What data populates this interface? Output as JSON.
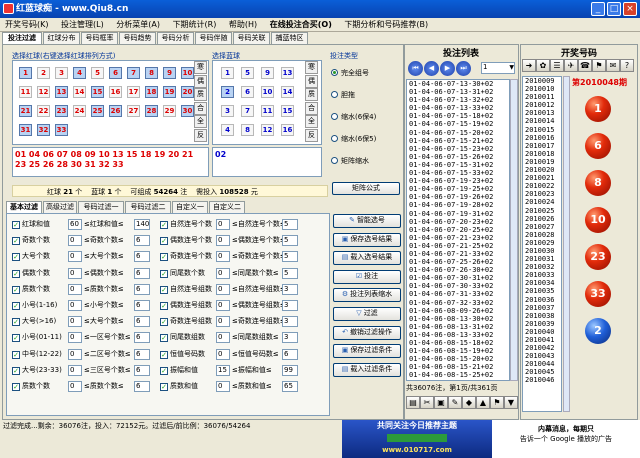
{
  "window": {
    "title": "红蓝球痴 - www.Qiu8.cn",
    "min": "_",
    "max": "□",
    "close": "×"
  },
  "menu": [
    "开奖号码(K)",
    "投注管理(L)",
    "分析菜单(A)",
    "下期统计(R)",
    "帮助(H)",
    "在线投注合买(O)",
    "下期分析和号码推荐(B)"
  ],
  "tabs": [
    "投注过滤",
    "红球分布",
    "号码框率",
    "号码趋势",
    "号码分析",
    "号码伴随",
    "号码关联",
    "捕蓝特区"
  ],
  "red_section": {
    "title": "选择红球(右键选择红球排列方式)",
    "balls": [
      "1",
      "2",
      "3",
      "4",
      "5",
      "6",
      "7",
      "8",
      "9",
      "10",
      "11",
      "12",
      "13",
      "14",
      "15",
      "16",
      "17",
      "18",
      "19",
      "20",
      "21",
      "22",
      "23",
      "24",
      "25",
      "26",
      "27",
      "28",
      "29",
      "30",
      "31",
      "32",
      "33"
    ],
    "selected": [
      "1",
      "4",
      "6",
      "7",
      "8",
      "9",
      "10",
      "13",
      "15",
      "18",
      "19",
      "20",
      "21",
      "23",
      "25",
      "26",
      "28",
      "30",
      "31",
      "32",
      "33"
    ],
    "side": [
      "寒",
      "偶",
      "质",
      "合",
      "全",
      "反"
    ],
    "summary": "01 04 06 07 08 09 10 13 15 18 19 20 21 23 25 26 28 30 31 32 33"
  },
  "blue_section": {
    "title": "选择蓝球",
    "balls": [
      "1",
      "5",
      "9",
      "13",
      "2",
      "6",
      "10",
      "14",
      "3",
      "7",
      "11",
      "15",
      "4",
      "8",
      "12",
      "16"
    ],
    "selected": [
      "2"
    ],
    "side": [
      "寒",
      "偶",
      "质",
      "合",
      "全",
      "反"
    ],
    "summary": "02"
  },
  "bet_type": {
    "title": "投注类型",
    "options": [
      "完全组号",
      "胆拖",
      "缩水(6保4)",
      "缩水(6保5)",
      "矩阵缩水"
    ],
    "selected": "完全组号",
    "button": "矩阵公式"
  },
  "stats": {
    "red_label": "红球",
    "red_count": "21",
    "red_unit": "个",
    "blue_label": "蓝球",
    "blue_count": "1",
    "blue_unit": "个",
    "groups_label": "可组成",
    "groups": "54264",
    "groups_unit": "注",
    "cost_label": "需投入",
    "cost": "108528",
    "cost_unit": "元"
  },
  "filter_tabs": [
    "基本过滤",
    "高级过滤",
    "号码过滤一",
    "号码过滤二",
    "自定义一",
    "自定义二"
  ],
  "filters_col1": [
    {
      "label": "红球和值",
      "min": "60",
      "mid": "≤红球和值≤",
      "max": "140"
    },
    {
      "label": "奇数个数",
      "min": "0",
      "mid": "≤奇数个数≤",
      "max": "6"
    },
    {
      "label": "大号个数",
      "min": "0",
      "mid": "≤大号个数≤",
      "max": "6"
    },
    {
      "label": "偶数个数",
      "min": "0",
      "mid": "≤偶数个数≤",
      "max": "6"
    },
    {
      "label": "质数个数",
      "min": "0",
      "mid": "≤质数个数≤",
      "max": "6"
    },
    {
      "label": "小号(1-16)",
      "min": "0",
      "mid": "≤小号个数≤",
      "max": "6"
    },
    {
      "label": "大号(>16)",
      "min": "0",
      "mid": "≤大号个数≤",
      "max": "6"
    },
    {
      "label": "小号(01-11)",
      "min": "0",
      "mid": "≤一区号个数≤",
      "max": "6"
    },
    {
      "label": "中号(12-22)",
      "min": "0",
      "mid": "≤二区号个数≤",
      "max": "6"
    },
    {
      "label": "大号(23-33)",
      "min": "0",
      "mid": "≤三区号个数≤",
      "max": "6"
    },
    {
      "label": "质数个数",
      "min": "0",
      "mid": "≤质数个数≤",
      "max": "6"
    }
  ],
  "filters_col2": [
    {
      "label": "自然连号个数",
      "min": "0",
      "mid": "≤自然连号个数≤",
      "max": "5"
    },
    {
      "label": "偶数连号个数",
      "min": "0",
      "mid": "≤偶数连号个数≤",
      "max": "5"
    },
    {
      "label": "奇数连号个数",
      "min": "0",
      "mid": "≤奇数连号个数≤",
      "max": "5"
    },
    {
      "label": "同尾数个数",
      "min": "0",
      "mid": "≤同尾数个数≤",
      "max": "5"
    },
    {
      "label": "自然连号组数",
      "min": "0",
      "mid": "≤自然连号组数≤",
      "max": "3"
    },
    {
      "label": "偶数连号组数",
      "min": "0",
      "mid": "≤偶数连号组数≤",
      "max": "3"
    },
    {
      "label": "奇数连号组数",
      "min": "0",
      "mid": "≤奇数连号组数≤",
      "max": "3"
    },
    {
      "label": "同尾数组数",
      "min": "0",
      "mid": "≤同尾数组数≤",
      "max": "3"
    },
    {
      "label": "恒值号码数",
      "min": "0",
      "mid": "≤恒值号码数≤",
      "max": "6"
    },
    {
      "label": "振幅和值",
      "min": "15",
      "mid": "≤振幅和值≤",
      "max": "99"
    },
    {
      "label": "质数和值",
      "min": "0",
      "mid": "≤质数和值≤",
      "max": "65"
    }
  ],
  "actions": [
    "智能选号",
    "保存选号结果",
    "载入选号结果",
    "投注",
    "投注列表缩水",
    "过滤",
    "撤销过滤操作",
    "保存过滤条件",
    "载入过滤条件"
  ],
  "bet_list": {
    "title": "投注列表",
    "page_select": "1",
    "rows": [
      "01-04-06-07-13-30+02",
      "01-04-06-07-13-31+02",
      "01-04-06-07-13-32+02",
      "01-04-06-07-13-33+02",
      "01-04-06-07-15-18+02",
      "01-04-06-07-15-19+02",
      "01-04-06-07-15-20+02",
      "01-04-06-07-15-21+02",
      "01-04-06-07-15-23+02",
      "01-04-06-07-15-26+02",
      "01-04-06-07-15-31+02",
      "01-04-06-07-15-33+02",
      "01-04-06-07-19-23+02",
      "01-04-06-07-19-25+02",
      "01-04-06-07-19-26+02",
      "01-04-06-07-19-28+02",
      "01-04-06-07-19-31+02",
      "01-04-06-07-20-23+02",
      "01-04-06-07-20-25+02",
      "01-04-06-07-21-23+02",
      "01-04-06-07-21-25+02",
      "01-04-06-07-21-33+02",
      "01-04-06-07-25-26+02",
      "01-04-06-07-26-30+02",
      "01-04-06-07-30-31+02",
      "01-04-06-07-30-33+02",
      "01-04-06-07-31-33+02",
      "01-04-06-07-32-33+02",
      "01-04-06-08-09-26+02",
      "01-04-06-08-13-30+02",
      "01-04-06-08-13-31+02",
      "01-04-06-08-13-33+02",
      "01-04-06-08-15-18+02",
      "01-04-06-08-15-19+02",
      "01-04-06-08-15-20+02",
      "01-04-06-08-15-21+02",
      "01-04-06-08-15-25+02"
    ],
    "footer": "共36076注，第1页/共361页"
  },
  "draw": {
    "title": "开奖号码",
    "period": "第2010048期",
    "list": [
      "2010009",
      "2010010",
      "2010011",
      "2010012",
      "2010013",
      "2010014",
      "2010015",
      "2010016",
      "2010017",
      "2010018",
      "2010019",
      "2010020",
      "2010021",
      "2010022",
      "2010023",
      "2010024",
      "2010025",
      "2010026",
      "2010027",
      "2010028",
      "2010029",
      "2010030",
      "2010031",
      "2010032",
      "2010033",
      "2010034",
      "2010035",
      "2010036",
      "2010037",
      "2010038",
      "2010039",
      "2010040",
      "2010041",
      "2010042",
      "2010043",
      "2010044",
      "2010045",
      "2010046"
    ],
    "balls": [
      "1",
      "6",
      "8",
      "10",
      "23",
      "33",
      "2"
    ]
  },
  "status": {
    "line1": "过滤完成...剩余：36076注，投入：72152元。过滤后/前比例：36076/54264",
    "line2": ""
  },
  "ad": {
    "title": "共同关注今日推荐主题",
    "url": "www.010717.com",
    "side1": "内幕消息，每期只",
    "side2": "告诉一个 Google 播放的广告"
  },
  "colors": {
    "title_bar": "#0842b0",
    "red_num": "#dd0000",
    "blue_num": "#0000cc",
    "period": "#dd0000"
  }
}
